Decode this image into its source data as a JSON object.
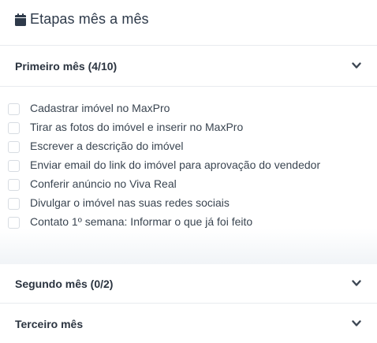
{
  "header": {
    "title": "Etapas mês a mês",
    "icon": "calendar-icon"
  },
  "sections": [
    {
      "label": "Primeiro mês (4/10)",
      "expanded": true,
      "tasks": [
        "Cadastrar imóvel no MaxPro",
        "Tirar as fotos do imóvel e inserir no MaxPro",
        "Escrever a descrição do imóvel",
        "Enviar email do link do imóvel para aprovação do vendedor",
        "Conferir anúncio no Viva Real",
        "Divulgar o imóvel nas suas redes sociais",
        "Contato 1º semana: Informar o que já foi feito"
      ]
    },
    {
      "label": "Segundo mês (0/2)",
      "expanded": false
    },
    {
      "label": "Terceiro mês",
      "expanded": false
    }
  ],
  "colors": {
    "text": "#2b3440",
    "border": "#e8ebef",
    "checkbox_border": "#d7dce2"
  }
}
